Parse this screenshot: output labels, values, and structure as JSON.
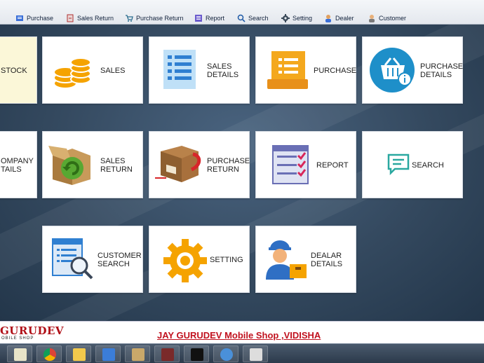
{
  "menu": {
    "items": [
      {
        "label": "Purchase"
      },
      {
        "label": "Sales Return"
      },
      {
        "label": "Purchase Return"
      },
      {
        "label": "Report"
      },
      {
        "label": "Search"
      },
      {
        "label": "Setting"
      },
      {
        "label": "Dealer"
      },
      {
        "label": "Customer"
      }
    ]
  },
  "tiles": {
    "stock": "STOCK",
    "sales": "SALES",
    "sales_details": "SALES\nDETAILS",
    "purchase": "PURCHASE",
    "purchase_details": "PURCHASE\nDETAILS",
    "company_details": "OMPANY\nTAILS",
    "sales_return": "SALES\nRETURN",
    "purchase_return": "PURCHASE\nRETURN",
    "report": "REPORT",
    "search": "SEARCH",
    "customer_search": "CUSTOMER\nSEARCH",
    "setting": "SETTING",
    "dealer_details": "DEALAR\nDETAILS"
  },
  "footer": {
    "logo_main": "GURUDEV",
    "logo_sub": "OBILE SHOP",
    "shop_name": "JAY GURUDEV Mobile Shop ,VIDISHA"
  },
  "icons": [
    "sales-coins-icon",
    "sales-details-list-icon",
    "purchase-document-icon",
    "purchase-details-basket-icon",
    "sales-return-box-icon",
    "purchase-return-box-icon",
    "report-checklist-icon",
    "search-chat-icon",
    "customer-search-icon",
    "setting-gear-icon",
    "dealer-worker-icon"
  ]
}
